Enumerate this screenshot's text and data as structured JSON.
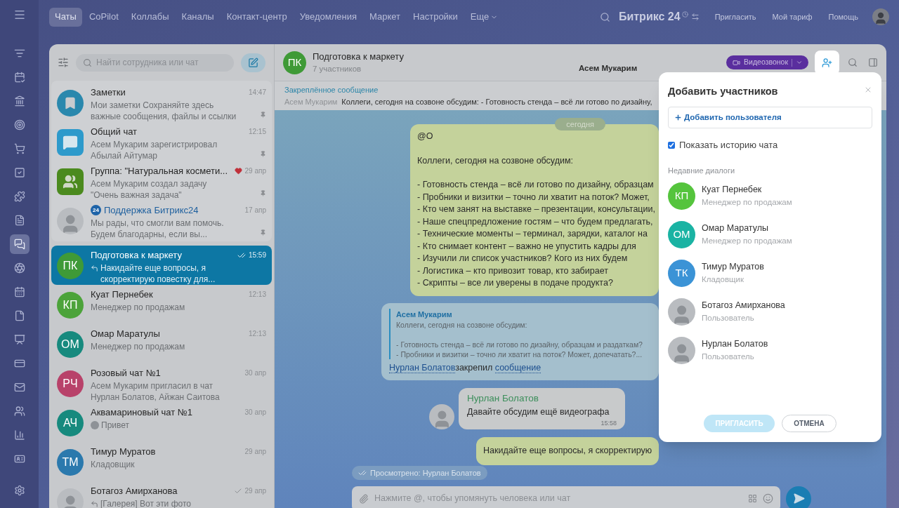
{
  "rail": [
    {
      "selected": false
    },
    {
      "selected": false
    },
    {
      "selected": false
    },
    {
      "selected": false
    },
    {
      "selected": false
    },
    {
      "selected": false
    },
    {
      "selected": false
    },
    {
      "selected": false
    },
    {
      "selected": true
    },
    {
      "selected": false
    },
    {
      "selected": false
    },
    {
      "selected": false
    },
    {
      "selected": false
    },
    {
      "selected": false
    },
    {
      "selected": false
    },
    {
      "selected": false
    },
    {
      "selected": false
    },
    {
      "selected": false
    }
  ],
  "top_nav": {
    "tabs": [
      {
        "label": "Чаты",
        "selected": true
      },
      {
        "label": "CoPilot",
        "selected": false
      },
      {
        "label": "Коллабы",
        "selected": false
      },
      {
        "label": "Каналы",
        "selected": false
      },
      {
        "label": "Контакт-центр",
        "selected": false
      },
      {
        "label": "Уведомления",
        "selected": false
      },
      {
        "label": "Маркет",
        "selected": false
      },
      {
        "label": "Настройки",
        "selected": false
      },
      {
        "label": "Еще",
        "selected": false,
        "dropdown": true
      }
    ],
    "logo": "Битрикс 24",
    "links": [
      "Пригласить",
      "Мой тариф",
      "Помощь"
    ]
  },
  "chat_list": {
    "search_placeholder": "Найти сотрудника или чат",
    "pinned_chats": [
      {
        "title": "Заметки",
        "preview": "Мои заметки Сохраняйте здесь важные сообщения, файлы и ссылки",
        "time": "14:47",
        "selected": false,
        "avatar": {
          "kind": "bookmark"
        }
      },
      {
        "title": "Общий чат",
        "preview": "Асем Мукарим зарегистрировал Абылай Айтумар",
        "time": "12:15",
        "selected": false,
        "avatar": {
          "kind": "chat"
        }
      },
      {
        "title": "Группа: \"Натуральная космети...",
        "preview": "Асем Мукарим создал задачу \"Очень важная задача\"",
        "time": "29 апр",
        "selected": false,
        "favorite": true,
        "avatar": {
          "kind": "group"
        }
      },
      {
        "title": "Поддержка Битрикс24",
        "badge": "24",
        "preview": "Мы рады, что смогли вам помочь. Будем благодарны, если вы...",
        "time": "17 апр",
        "selected": false,
        "avatar": {
          "kind": "photo"
        }
      }
    ],
    "chats": [
      {
        "title": "Подготовка к маркету",
        "preview": "Накидайте еще вопросы, я скорректирую повестку для...",
        "reply": true,
        "time": "15:59",
        "delivered": true,
        "read": true,
        "selected": true,
        "avatar": {
          "kind": "initials",
          "text": "ПК",
          "color": "#3f9a37"
        }
      },
      {
        "title": "Куат Пернебек",
        "preview": "Менеджер по продажам",
        "time": "12:13",
        "selected": false,
        "avatar": {
          "kind": "initials",
          "text": "КП",
          "color": "#4ca33a"
        }
      },
      {
        "title": "Омар Маратулы",
        "preview": "Менеджер по продажам",
        "time": "12:13",
        "selected": false,
        "avatar": {
          "kind": "initials",
          "text": "ОМ",
          "color": "#178a7e"
        }
      },
      {
        "title": "Розовый чат №1",
        "preview": "Асем Мукарим пригласил в чат Нурлан Болатов, Айжан Саитова",
        "time": "30 апр",
        "selected": false,
        "avatar": {
          "kind": "initials",
          "text": "РЧ",
          "color": "#b8426a"
        }
      },
      {
        "title": "Аквамариновый чат №1",
        "preview": "Привет",
        "preview_avatar": true,
        "time": "30 апр",
        "selected": false,
        "avatar": {
          "kind": "initials",
          "text": "АЧ",
          "color": "#178a7e"
        }
      },
      {
        "title": "Тимур Муратов",
        "preview": "Кладовщик",
        "time": "29 апр",
        "selected": false,
        "avatar": {
          "kind": "initials",
          "text": "ТМ",
          "color": "#2b79ad"
        }
      },
      {
        "title": "Ботагоз Амирханова",
        "preview": "[Галерея] Вот эти фото",
        "reply": true,
        "time": "29 апр",
        "delivered": true,
        "read": false,
        "selected": false,
        "avatar": {
          "kind": "photo"
        }
      }
    ]
  },
  "chat": {
    "title": "Подготовка к маркету",
    "subtitle": "7 участников",
    "typing": "Асем Мукарим",
    "avatar": {
      "kind": "initials",
      "text": "ПК",
      "color": "#3f9a37"
    },
    "call_button": "Видеозвонок",
    "pinned": {
      "label": "Закреплённое сообщение",
      "author": "Асем Мукарим",
      "text": "Коллеги, сегодня на созвоне обсудим: - Готовность стенда – всё ли готово по дизайну,"
    },
    "date": "сегодня",
    "messages": [
      {
        "kind": "outgoing",
        "paragraphs": [
          [
            "@О"
          ],
          [
            "Коллеги, сегодня на созвоне обсудим:"
          ],
          [
            "- Готовность стенда – всё ли готово по дизайну, образцам",
            "- Пробники и визитки – точно ли хватит на поток? Может,",
            "- Кто чем занят на выставке – презентации, консультации,",
            "- Наше спецпредложение гостям – что будем предлагать,",
            "- Технические моменты – терминал, зарядки, каталог на",
            "- Кто снимает контент – важно не упустить кадры для",
            "- Изучили ли список участников? Кого из них будем",
            "- Логистика – кто привозит товар, кто забирает",
            "- Скрипты – все ли уверены в подаче продукта?"
          ]
        ]
      },
      {
        "kind": "system",
        "quote_author": "Асем Мукарим",
        "quote_paragraphs": [
          [
            "Коллеги, сегодня на созвоне обсудим:"
          ],
          [
            "- Готовность стенда – всё ли готово по дизайну, образцам и раздаткам?",
            "- Пробники и визитки – точно ли хватит на поток? Может, допечатать?..."
          ]
        ],
        "actor": "Нурлан Болатов",
        "action": "закрепил",
        "link": "сообщение"
      },
      {
        "kind": "incoming",
        "author": "Нурлан Болатов",
        "text": "Давайте обсудим ещё видеографа",
        "time": "15:58"
      },
      {
        "kind": "outgoing",
        "paragraphs": [
          [
            "Накидайте еще вопросы, я скорректирую"
          ]
        ]
      }
    ],
    "seen": "Просмотрено: Нурлан Болатов",
    "composer_placeholder": "Нажмите @, чтобы упомянуть человека или чат"
  },
  "add_members_dialog": {
    "title": "Добавить участников",
    "add_user": "Добавить пользователя",
    "show_history": {
      "label": "Показать историю чата",
      "checked": true
    },
    "section": "Недавние диалоги",
    "users": [
      {
        "name": "Куат Пернебек",
        "role": "Менеджер по продажам",
        "avatar": {
          "kind": "initials",
          "text": "КП",
          "color": "#55c43d"
        }
      },
      {
        "name": "Омар Маратулы",
        "role": "Менеджер по продажам",
        "avatar": {
          "kind": "initials",
          "text": "ОМ",
          "color": "#1ab3a3"
        }
      },
      {
        "name": "Тимур Муратов",
        "role": "Кладовщик",
        "avatar": {
          "kind": "initials",
          "text": "ТК",
          "color": "#3b93d6"
        }
      },
      {
        "name": "Ботагоз Амирханова",
        "role": "Пользователь",
        "avatar": {
          "kind": "photo"
        }
      },
      {
        "name": "Нурлан Болатов",
        "role": "Пользователь",
        "avatar": {
          "kind": "photo"
        }
      }
    ],
    "invite": {
      "label": "ПРИГЛАСИТЬ",
      "disabled": true
    },
    "cancel": "ОТМЕНА"
  }
}
